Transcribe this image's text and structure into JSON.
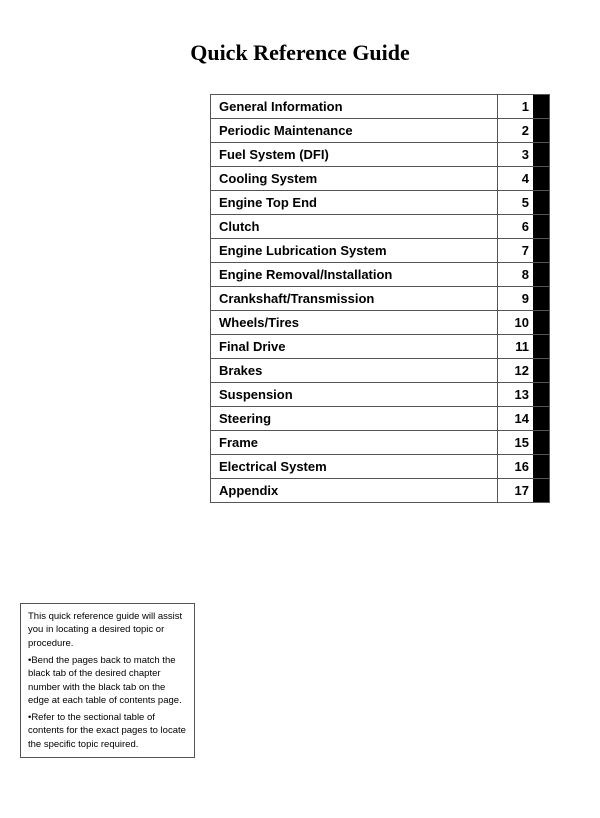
{
  "title": "Quick Reference Guide",
  "toc": {
    "items": [
      {
        "label": "General Information",
        "number": "1"
      },
      {
        "label": "Periodic Maintenance",
        "number": "2"
      },
      {
        "label": "Fuel System (DFI)",
        "number": "3"
      },
      {
        "label": "Cooling System",
        "number": "4"
      },
      {
        "label": "Engine Top End",
        "number": "5"
      },
      {
        "label": "Clutch",
        "number": "6"
      },
      {
        "label": "Engine Lubrication System",
        "number": "7"
      },
      {
        "label": "Engine Removal/Installation",
        "number": "8"
      },
      {
        "label": "Crankshaft/Transmission",
        "number": "9"
      },
      {
        "label": "Wheels/Tires",
        "number": "10"
      },
      {
        "label": "Final Drive",
        "number": "11"
      },
      {
        "label": "Brakes",
        "number": "12"
      },
      {
        "label": "Suspension",
        "number": "13"
      },
      {
        "label": "Steering",
        "number": "14"
      },
      {
        "label": "Frame",
        "number": "15"
      },
      {
        "label": "Electrical System",
        "number": "16"
      },
      {
        "label": "Appendix",
        "number": "17"
      }
    ]
  },
  "note": {
    "intro": "This quick reference guide will assist you in locating a desired topic or procedure.",
    "bullet1": "•Bend the pages back to match the black tab of the desired chapter number with the black tab on the edge at each table of contents page.",
    "bullet2": "•Refer to the sectional table of contents for the exact pages to locate the specific topic required."
  }
}
